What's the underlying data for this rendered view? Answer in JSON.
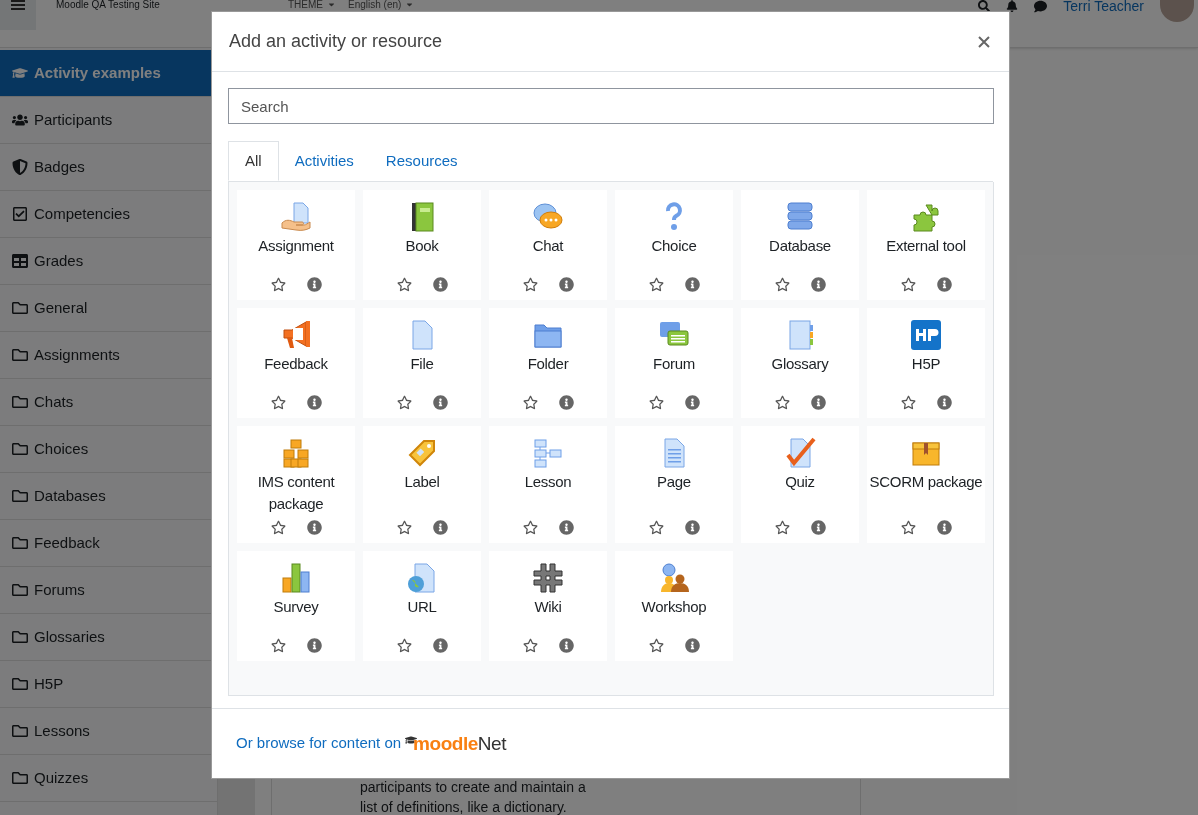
{
  "header": {
    "site_name": "Moodle QA Testing Site",
    "menus": [
      "THEME",
      "English (en)"
    ],
    "user_name": "Terri Teacher"
  },
  "sidebar": {
    "items": [
      {
        "label": "Activity examples",
        "kind": "course",
        "selected": true
      },
      {
        "label": "Participants",
        "kind": "participants",
        "selected": false
      },
      {
        "label": "Badges",
        "kind": "badges",
        "selected": false
      },
      {
        "label": "Competencies",
        "kind": "competencies",
        "selected": false
      },
      {
        "label": "Grades",
        "kind": "grades",
        "selected": false
      },
      {
        "label": "General",
        "kind": "section",
        "selected": false
      },
      {
        "label": "Assignments",
        "kind": "section",
        "selected": false
      },
      {
        "label": "Chats",
        "kind": "section",
        "selected": false
      },
      {
        "label": "Choices",
        "kind": "section",
        "selected": false
      },
      {
        "label": "Databases",
        "kind": "section",
        "selected": false
      },
      {
        "label": "Feedback",
        "kind": "section",
        "selected": false
      },
      {
        "label": "Forums",
        "kind": "section",
        "selected": false
      },
      {
        "label": "Glossaries",
        "kind": "section",
        "selected": false
      },
      {
        "label": "H5P",
        "kind": "section",
        "selected": false
      },
      {
        "label": "Lessons",
        "kind": "section",
        "selected": false
      },
      {
        "label": "Quizzes",
        "kind": "section",
        "selected": false
      }
    ]
  },
  "background_text": [
    "participants to create and maintain a",
    "list of definitions, like a dictionary."
  ],
  "modal": {
    "title": "Add an activity or resource",
    "search": {
      "placeholder": "Search"
    },
    "tabs": [
      {
        "label": "All",
        "selected": true
      },
      {
        "label": "Activities",
        "selected": false
      },
      {
        "label": "Resources",
        "selected": false
      }
    ],
    "modules": [
      {
        "name": "Assignment",
        "starred": false
      },
      {
        "name": "Book",
        "starred": false
      },
      {
        "name": "Chat",
        "starred": false
      },
      {
        "name": "Choice",
        "starred": false
      },
      {
        "name": "Database",
        "starred": false
      },
      {
        "name": "External tool",
        "starred": false
      },
      {
        "name": "Feedback",
        "starred": false
      },
      {
        "name": "File",
        "starred": false
      },
      {
        "name": "Folder",
        "starred": false
      },
      {
        "name": "Forum",
        "starred": false
      },
      {
        "name": "Glossary",
        "starred": false
      },
      {
        "name": "H5P",
        "starred": false
      },
      {
        "name": "IMS content package",
        "starred": false
      },
      {
        "name": "Label",
        "starred": false
      },
      {
        "name": "Lesson",
        "starred": false
      },
      {
        "name": "Page",
        "starred": false
      },
      {
        "name": "Quiz",
        "starred": false
      },
      {
        "name": "SCORM package",
        "starred": false
      },
      {
        "name": "Survey",
        "starred": false
      },
      {
        "name": "URL",
        "starred": false
      },
      {
        "name": "Wiki",
        "starred": false
      },
      {
        "name": "Workshop",
        "starred": false
      }
    ],
    "footer": {
      "link": "Or browse for content on",
      "logo": [
        "moodle",
        "Net"
      ]
    }
  }
}
